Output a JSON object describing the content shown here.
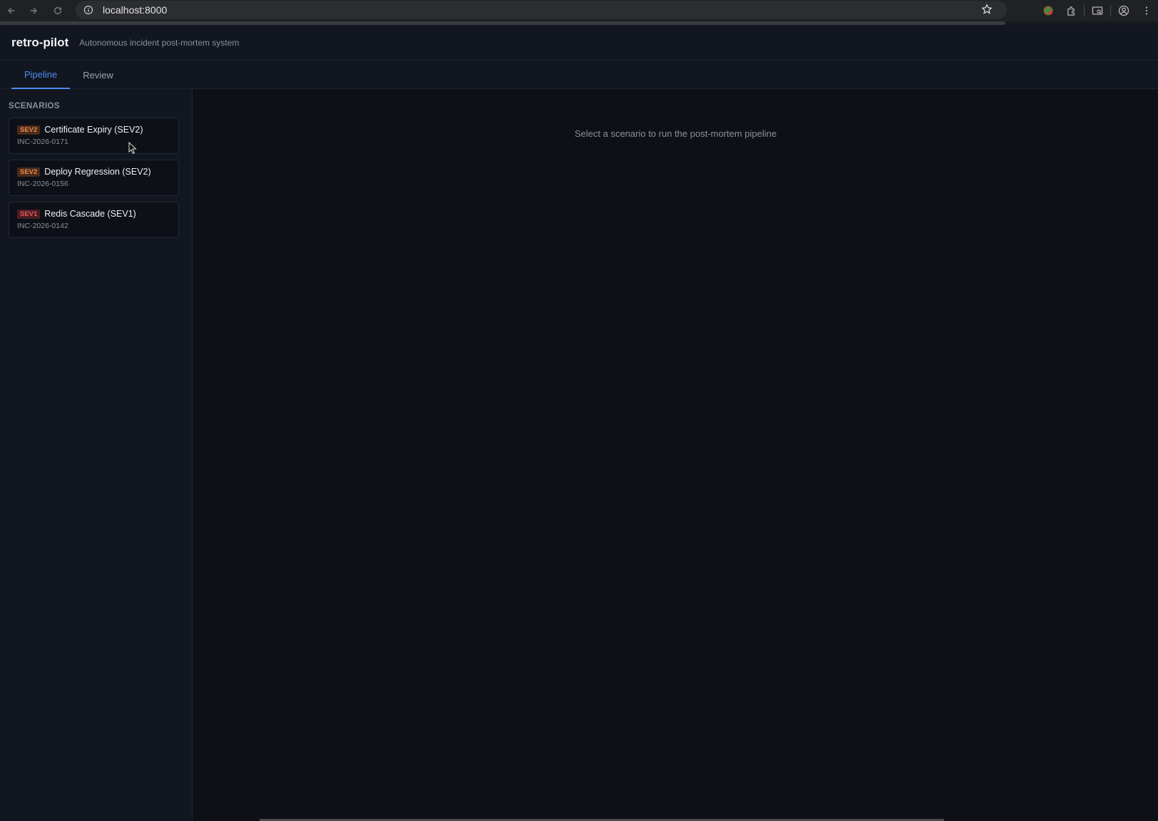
{
  "browser": {
    "url": "localhost:8000",
    "icons": [
      "back-icon",
      "forward-icon",
      "reload-icon",
      "site-info-icon",
      "star-icon",
      "extension-color-icon",
      "puzzle-icon",
      "tab-search-icon",
      "profile-icon",
      "menu-icon"
    ]
  },
  "app": {
    "title": "retro-pilot",
    "subtitle": "Autonomous incident post-mortem system"
  },
  "tabs": [
    {
      "label": "Pipeline",
      "active": true
    },
    {
      "label": "Review",
      "active": false
    }
  ],
  "sidebar": {
    "section_title": "SCENARIOS",
    "scenarios": [
      {
        "severity": "SEV2",
        "title": "Certificate Expiry (SEV2)",
        "id": "INC-2026-0171"
      },
      {
        "severity": "SEV2",
        "title": "Deploy Regression (SEV2)",
        "id": "INC-2026-0156"
      },
      {
        "severity": "SEV1",
        "title": "Redis Cascade (SEV1)",
        "id": "INC-2026-0142"
      }
    ]
  },
  "main": {
    "empty_message": "Select a scenario to run the post-mortem pipeline"
  },
  "colors": {
    "accent": "#4c8dee",
    "sev2": "#e8894b",
    "sev1": "#e35a5a",
    "background": "#0d1016",
    "panel": "#121620"
  }
}
